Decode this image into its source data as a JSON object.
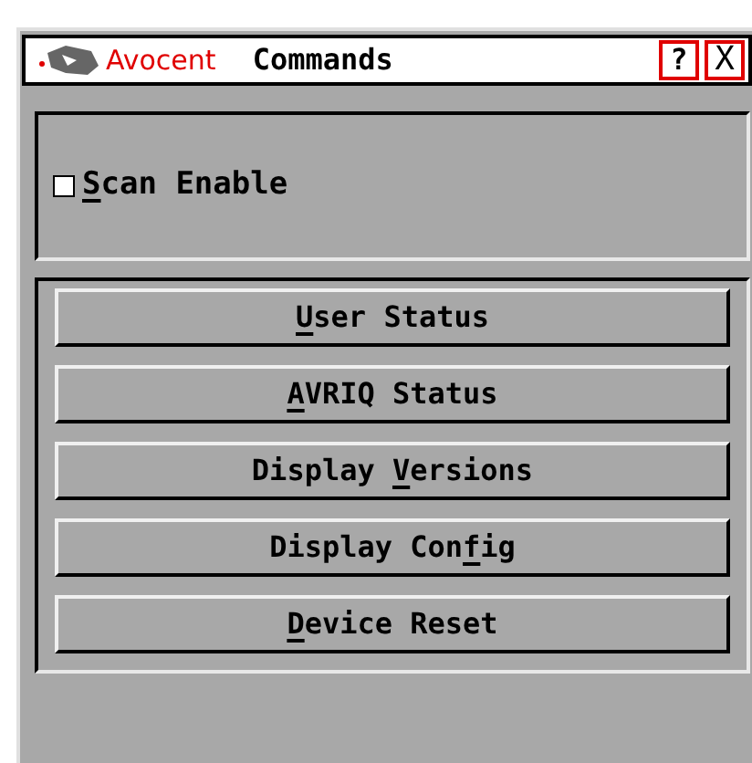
{
  "window": {
    "brand": "Avocent",
    "title": "Commands",
    "help_button": "?",
    "close_button": "X"
  },
  "scan_enable": {
    "checked": false,
    "access_key": "S",
    "label_after": "can Enable"
  },
  "commands": [
    {
      "access_key": "U",
      "label_after": "ser Status"
    },
    {
      "access_key": "A",
      "label_after": "VRIQ Status"
    },
    {
      "label_before": "Display ",
      "access_key": "V",
      "label_after": "ersions"
    },
    {
      "label_before": "Display Con",
      "access_key": "f",
      "label_after": "ig"
    },
    {
      "access_key": "D",
      "label_after": "evice Reset"
    }
  ]
}
